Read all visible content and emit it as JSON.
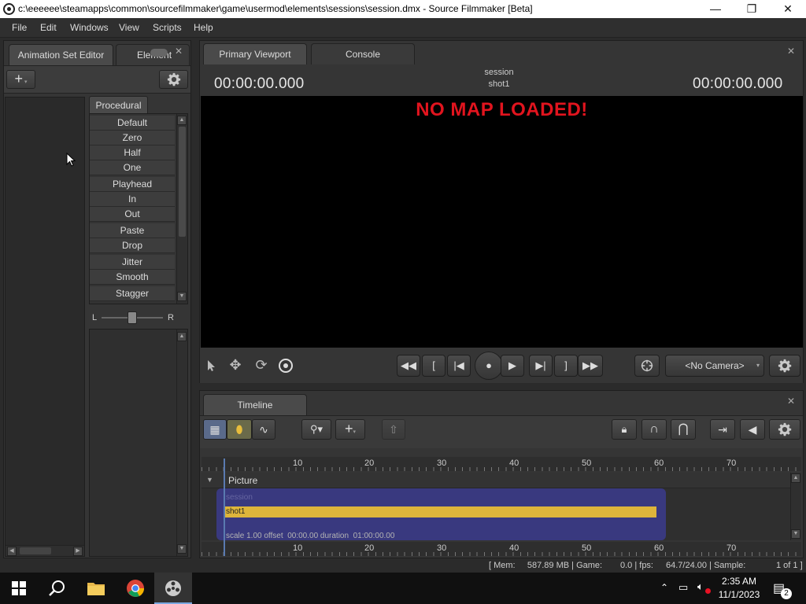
{
  "window": {
    "title": "c:\\eeeeee\\steamapps\\common\\sourcefilmmaker\\game\\usermod\\elements\\sessions\\session.dmx - Source Filmmaker [Beta]",
    "minimize": "—",
    "maximize": "❐",
    "close": "✕"
  },
  "menu": [
    "File",
    "Edit",
    "Windows",
    "View",
    "Scripts",
    "Help"
  ],
  "left_panel": {
    "tabs": [
      "Animation Set Editor",
      "Element"
    ],
    "add_glyph": "+",
    "procedural_tab": "Procedural",
    "procedural_items": [
      "Default",
      "Zero",
      "Half",
      "One",
      "Playhead",
      "In",
      "Out",
      "Paste",
      "Drop",
      "Jitter",
      "Smooth",
      "Stagger"
    ],
    "slider_left": "L",
    "slider_right": "R"
  },
  "viewport": {
    "tabs": [
      "Primary Viewport",
      "Console"
    ],
    "timecode_left": "00:00:00.000",
    "timecode_right": "00:00:00.000",
    "session_name": "session",
    "shot_name": "shot1",
    "no_map_message": "NO MAP LOADED!",
    "camera_label": "<No Camera>"
  },
  "timeline": {
    "tab": "Timeline",
    "ruler_labels": [
      "10",
      "20",
      "30",
      "40",
      "50",
      "60",
      "70"
    ],
    "track_name": "Picture",
    "clip_header": "session",
    "clip_name": "shot1",
    "clip_info": "scale 1.00 offset  00:00.00 duration  01:00:00.00"
  },
  "status": {
    "mem": "[ Mem:     587.89 MB | Game:",
    "game": "0.0 | fps:",
    "fps": "64.7/24.00 | Sample:",
    "sample": "1 of 1 ]"
  },
  "taskbar": {
    "time": "2:35 AM",
    "date": "11/1/2023",
    "notifications": "2"
  },
  "colors": {
    "accent_red": "#e1141e",
    "clip_yellow": "#e8bd3c",
    "clip_blue": "#3a3a84"
  }
}
